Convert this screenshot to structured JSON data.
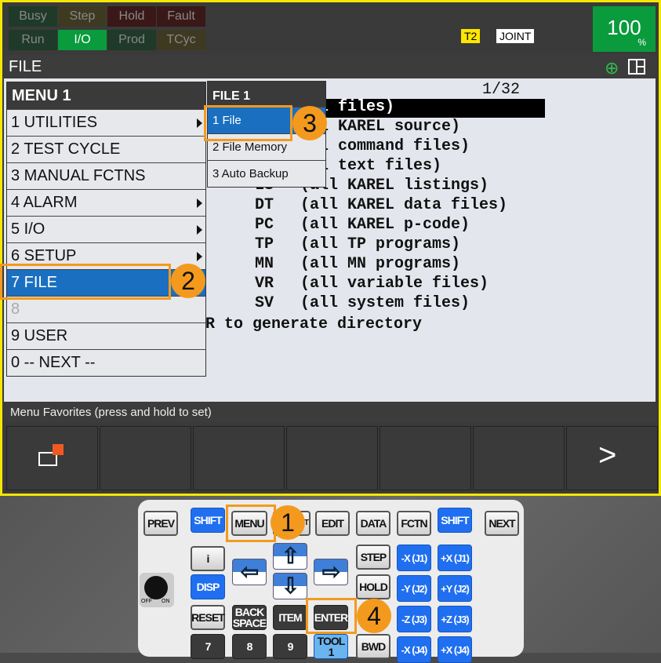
{
  "status": {
    "indicators": [
      {
        "label": "Busy",
        "bg": "#1f3a28"
      },
      {
        "label": "Step",
        "bg": "#3e3a22"
      },
      {
        "label": "Hold",
        "bg": "#3a1818"
      },
      {
        "label": "Fault",
        "bg": "#3a1818"
      },
      {
        "label": "Run",
        "bg": "#1f3a28"
      },
      {
        "label": "I/O",
        "bg": "#0a9b3c",
        "active": true
      },
      {
        "label": "Prod",
        "bg": "#1f3a28"
      },
      {
        "label": "TCyc",
        "bg": "#3e3a22"
      }
    ],
    "mode": "T2",
    "coord": "JOINT",
    "override": "100",
    "override_unit": "%"
  },
  "title": "FILE",
  "icons": {
    "zoom": "zoom-in-icon",
    "layout": "split-screen-icon"
  },
  "page": "1/32",
  "listing": [
    {
      "code": "",
      "desc": "l files)",
      "cursor": true
    },
    {
      "code": "",
      "desc": "l KAREL source)"
    },
    {
      "code": "",
      "desc": "l command files)"
    },
    {
      "code": "",
      "desc": "l text files)"
    },
    {
      "code": "LS",
      "desc": "(all KAREL listings)"
    },
    {
      "code": "DT",
      "desc": "(all KAREL data files)"
    },
    {
      "code": "PC",
      "desc": "(all KAREL p-code)"
    },
    {
      "code": "TP",
      "desc": "(all TP programs)"
    },
    {
      "code": "MN",
      "desc": "(all MN programs)"
    },
    {
      "code": "VR",
      "desc": "(all variable files)"
    },
    {
      "code": "SV",
      "desc": "(all system files)"
    }
  ],
  "hint": "R to generate directory",
  "menu": {
    "title": "MENU  1",
    "items": [
      {
        "label": "1 UTILITIES",
        "sub": true
      },
      {
        "label": "2 TEST CYCLE"
      },
      {
        "label": "3 MANUAL FCTNS"
      },
      {
        "label": "4 ALARM",
        "sub": true
      },
      {
        "label": "5 I/O",
        "sub": true
      },
      {
        "label": "6 SETUP",
        "sub": true
      },
      {
        "label": "7 FILE",
        "selected": true
      },
      {
        "label": "8",
        "disabled": true
      },
      {
        "label": "9 USER"
      },
      {
        "label": "0 -- NEXT --"
      }
    ]
  },
  "submenu": {
    "title": "FILE  1",
    "items": [
      {
        "label": "1 File",
        "selected": true
      },
      {
        "label": "2 File Memory"
      },
      {
        "label": "3 Auto Backup"
      }
    ]
  },
  "callouts": [
    "1",
    "2",
    "3",
    "4"
  ],
  "favorites": "Menu Favorites (press and hold to set)",
  "next_symbol": ">",
  "keypad": {
    "prev": "PREV",
    "shift": "SHIFT",
    "menu": "MENU",
    "select": "SELECT",
    "edit": "EDIT",
    "data": "DATA",
    "fctn": "FCTN",
    "next": "NEXT",
    "info": "i",
    "disp": "DISP",
    "reset": "RESET",
    "backspace": "BACK SPACE",
    "item": "ITEM",
    "enter": "ENTER",
    "step": "STEP",
    "hold": "HOLD",
    "bwd": "BWD",
    "tool": "TOOL 1",
    "jog": [
      "-X (J1)",
      "+X (J1)",
      "-Y (J2)",
      "+Y (J2)",
      "-Z (J3)",
      "+Z (J3)",
      "-X (J4)",
      "+X (J4)"
    ],
    "digits": [
      "7",
      "8",
      "9"
    ],
    "switch_off": "OFF",
    "switch_on": "ON"
  },
  "accent": "#f39a1e"
}
